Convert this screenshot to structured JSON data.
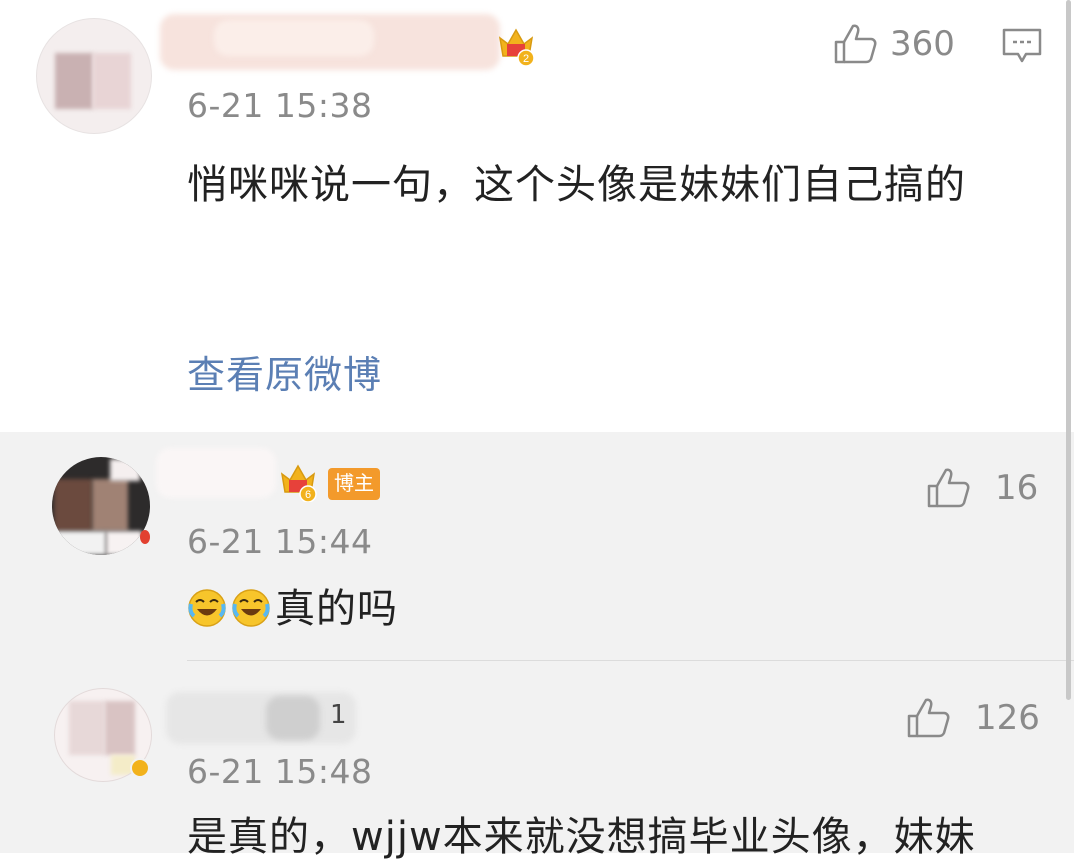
{
  "main_comment": {
    "time": "6-21 15:38",
    "like_count": "360",
    "content": "悄咪咪说一句，这个头像是妹妹们自己搞的",
    "view_original": "查看原微博",
    "crown_level": "2"
  },
  "replies": [
    {
      "time": "6-21 15:44",
      "like_count": "16",
      "content": "真的吗",
      "emoji_count": 2,
      "crown_level": "6",
      "badge": "博主"
    },
    {
      "time": "6-21 15:48",
      "like_count": "126",
      "username_fragment": "1",
      "content": "是真的，wjjw本来就没想搞毕业头像，妹妹"
    }
  ],
  "icons": {
    "like": "thumbs-up-icon",
    "comment": "comment-icon",
    "crown": "crown-badge-icon",
    "emoji": "laughing-crying-emoji-icon"
  },
  "colors": {
    "link": "#5b7fb4",
    "badge": "#f39a2b",
    "crown": "#f2b21c",
    "reply_bg": "#f2f2f2"
  }
}
